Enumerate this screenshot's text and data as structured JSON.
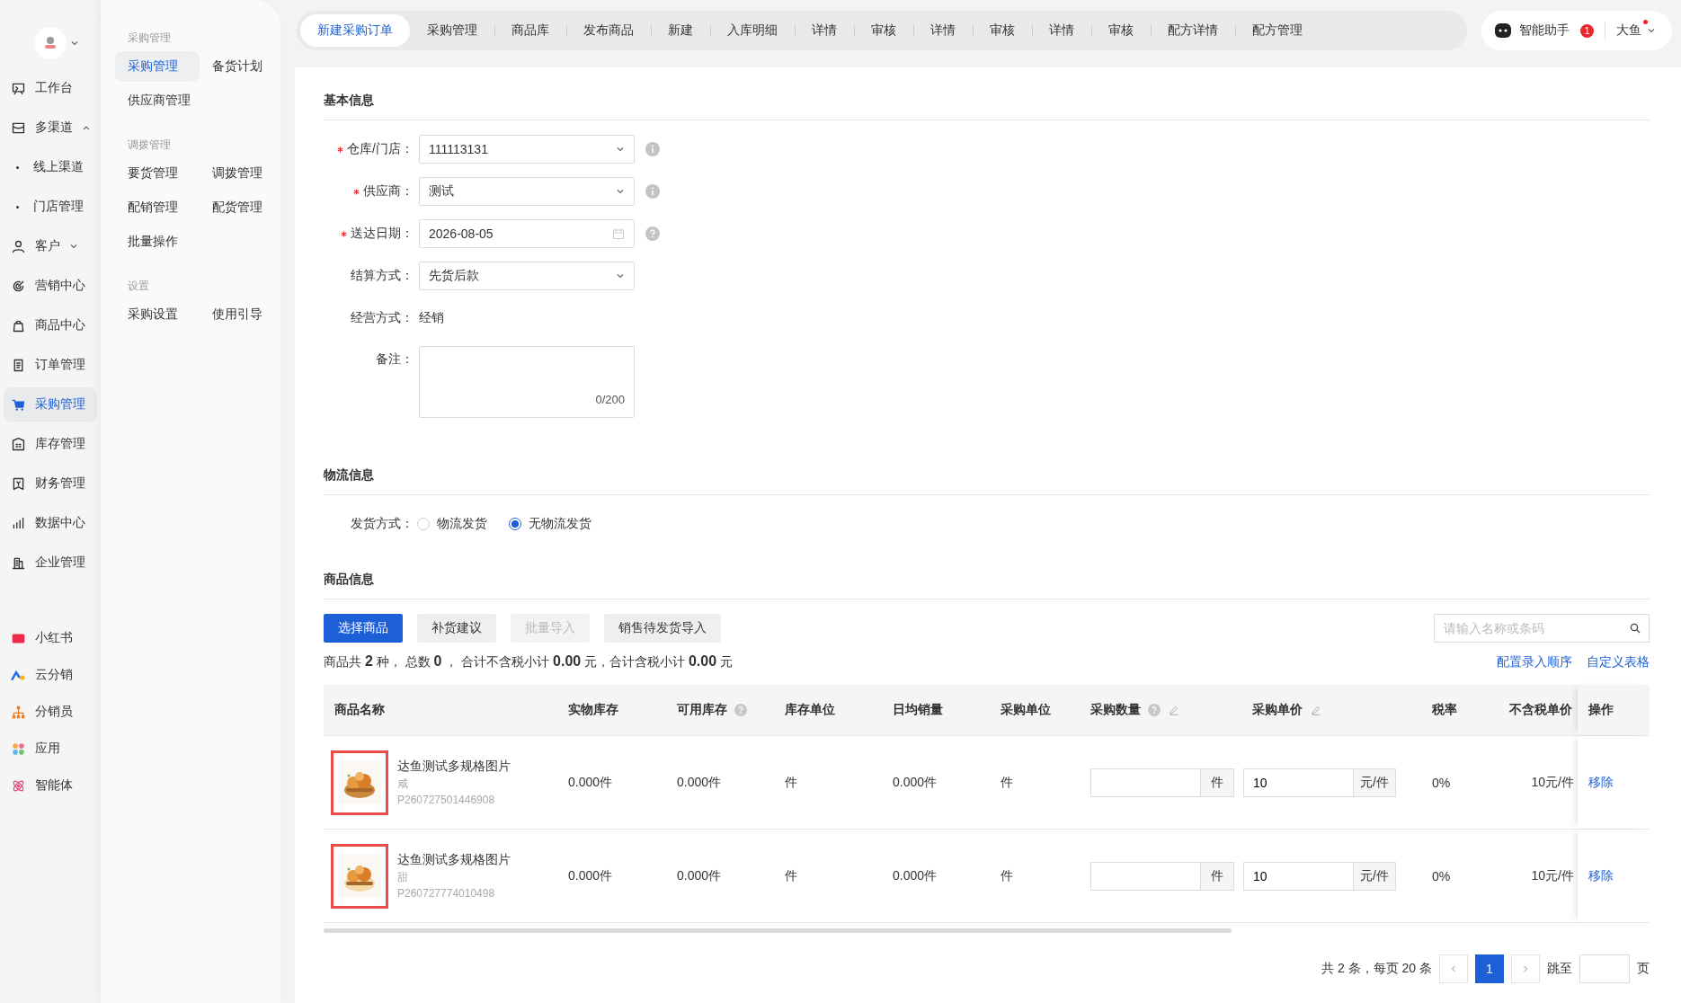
{
  "nav": {
    "items": [
      {
        "label": "工作台",
        "kind": "item",
        "selected": false
      },
      {
        "label": "多渠道",
        "kind": "group",
        "expanded": true,
        "selected": false
      },
      {
        "label": "线上渠道",
        "kind": "sub",
        "selected": false
      },
      {
        "label": "门店管理",
        "kind": "sub",
        "selected": false
      },
      {
        "label": "客户",
        "kind": "group",
        "expanded": false,
        "selected": false
      },
      {
        "label": "营销中心",
        "kind": "item",
        "selected": false
      },
      {
        "label": "商品中心",
        "kind": "item",
        "selected": false
      },
      {
        "label": "订单管理",
        "kind": "item",
        "selected": false
      },
      {
        "label": "采购管理",
        "kind": "item",
        "selected": true
      },
      {
        "label": "库存管理",
        "kind": "item",
        "selected": false
      },
      {
        "label": "财务管理",
        "kind": "item",
        "selected": false
      },
      {
        "label": "数据中心",
        "kind": "item",
        "selected": false
      },
      {
        "label": "企业管理",
        "kind": "item",
        "selected": false
      }
    ],
    "apps": [
      {
        "label": "小红书"
      },
      {
        "label": "云分销"
      },
      {
        "label": "分销员"
      },
      {
        "label": "应用"
      },
      {
        "label": "智能体"
      }
    ]
  },
  "submenu": [
    {
      "title": "采购管理",
      "items": [
        {
          "label": "采购管理",
          "selected": true
        },
        {
          "label": "备货计划",
          "selected": false
        },
        {
          "label": "供应商管理",
          "selected": false
        }
      ]
    },
    {
      "title": "调拨管理",
      "items": [
        {
          "label": "要货管理",
          "selected": false
        },
        {
          "label": "调拨管理",
          "selected": false
        },
        {
          "label": "配销管理",
          "selected": false
        },
        {
          "label": "配货管理",
          "selected": false
        },
        {
          "label": "批量操作",
          "selected": false
        }
      ]
    },
    {
      "title": "设置",
      "items": [
        {
          "label": "采购设置",
          "selected": false
        },
        {
          "label": "使用引导",
          "selected": false
        }
      ]
    }
  ],
  "tabs": [
    {
      "label": "新建采购订单",
      "selected": true
    },
    {
      "label": "采购管理",
      "selected": false
    },
    {
      "label": "商品库",
      "selected": false
    },
    {
      "label": "发布商品",
      "selected": false
    },
    {
      "label": "新建",
      "selected": false
    },
    {
      "label": "入库明细",
      "selected": false
    },
    {
      "label": "详情",
      "selected": false
    },
    {
      "label": "审核",
      "selected": false
    },
    {
      "label": "详情",
      "selected": false
    },
    {
      "label": "审核",
      "selected": false
    },
    {
      "label": "详情",
      "selected": false
    },
    {
      "label": "审核",
      "selected": false
    },
    {
      "label": "配方详情",
      "selected": false
    },
    {
      "label": "配方管理",
      "selected": false
    }
  ],
  "header": {
    "assistant": {
      "label": "智能助手",
      "badge": "1"
    },
    "user": {
      "name": "大鱼",
      "unread": true
    }
  },
  "basic": {
    "title": "基本信息",
    "fields": [
      {
        "kind": "select",
        "label": "仓库/门店：",
        "required": true,
        "value": "111113131",
        "hint": true
      },
      {
        "kind": "select",
        "label": "供应商：",
        "required": true,
        "value": "测试",
        "hint": true
      },
      {
        "kind": "date",
        "label": "送达日期：",
        "required": true,
        "value": "2026-08-05",
        "hint": true
      },
      {
        "kind": "select",
        "label": "结算方式：",
        "required": false,
        "value": "先货后款",
        "hint": false
      },
      {
        "kind": "text",
        "label": "经营方式：",
        "required": false,
        "value": "经销"
      },
      {
        "kind": "textarea",
        "label": "备注：",
        "required": false,
        "counter": "0/200"
      }
    ]
  },
  "logistics": {
    "title": "物流信息",
    "label": "发货方式：",
    "options": [
      {
        "label": "物流发货",
        "selected": false
      },
      {
        "label": "无物流发货",
        "selected": true
      }
    ]
  },
  "products": {
    "title": "商品信息",
    "buttons": [
      {
        "label": "选择商品",
        "kind": "primary"
      },
      {
        "label": "补货建议",
        "kind": "default"
      },
      {
        "label": "批量导入",
        "kind": "disabled"
      },
      {
        "label": "销售待发货导入",
        "kind": "default"
      }
    ],
    "search": {
      "placeholder": "请输入名称或条码"
    },
    "summary": "商品共 **2** 种， 总数 **0** ， 合计不含税小计 **0.00** 元，合计含税小计 **0.00** 元",
    "links": [
      "配置录入顺序",
      "自定义表格"
    ],
    "columns": [
      {
        "label": "商品名称",
        "help": false,
        "editable": false
      },
      {
        "label": "实物库存",
        "help": false,
        "editable": false
      },
      {
        "label": "可用库存",
        "help": true,
        "editable": false
      },
      {
        "label": "库存单位",
        "help": false,
        "editable": false
      },
      {
        "label": "日均销量",
        "help": false,
        "editable": false
      },
      {
        "label": "采购单位",
        "help": false,
        "editable": false
      },
      {
        "label": "采购数量",
        "help": true,
        "editable": true
      },
      {
        "label": "采购单价",
        "help": false,
        "editable": true
      },
      {
        "label": "税率",
        "help": false,
        "editable": false
      },
      {
        "label": "不含税单价",
        "help": false,
        "editable": false
      },
      {
        "label": "操作",
        "help": false,
        "editable": false
      }
    ],
    "rows": [
      {
        "highlighted": true,
        "name": "达鱼测试多规格图片",
        "spec": "咸",
        "code": "P260727501446908",
        "stock": "0.000件",
        "available": "0.000件",
        "unit": "件",
        "daily": "0.000件",
        "purchase_unit": "件",
        "qty_unit": "件",
        "price": "10",
        "price_unit": "元/件",
        "tax": "0%",
        "net_price": "10元/件",
        "action": "移除"
      },
      {
        "highlighted": true,
        "name": "达鱼测试多规格图片",
        "spec": "甜",
        "code": "P260727774010498",
        "stock": "0.000件",
        "available": "0.000件",
        "unit": "件",
        "daily": "0.000件",
        "purchase_unit": "件",
        "qty_unit": "件",
        "price": "10",
        "price_unit": "元/件",
        "tax": "0%",
        "net_price": "10元/件",
        "action": "移除"
      }
    ],
    "pagination": {
      "total": "共 2 条，每页 20 条",
      "pages": [
        {
          "label": "1",
          "selected": true
        }
      ],
      "jump": "跳至",
      "suffix": "页"
    }
  }
}
